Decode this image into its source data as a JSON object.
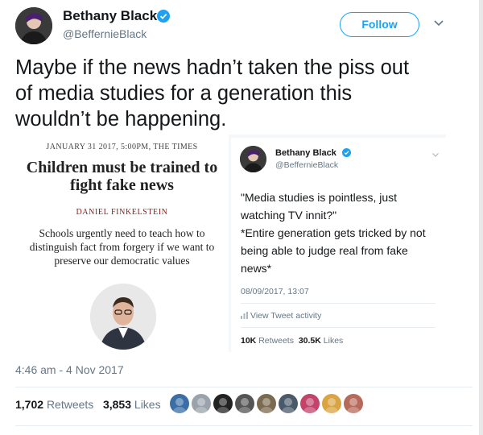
{
  "author": {
    "display_name": "Bethany Black",
    "handle": "@BeffernieBlack",
    "verified": true
  },
  "follow_label": "Follow",
  "tweet_lines": [
    "Maybe if the news hadn’t taken the piss out",
    "of media studies for a generation this",
    "wouldn’t be happening."
  ],
  "news_clip": {
    "dateline": "JANUARY 31 2017, 5:00PM, THE TIMES",
    "headline_lines": [
      "Children must be trained to",
      "fight fake news"
    ],
    "author": "DANIEL FINKELSTEIN",
    "summary_lines": [
      "Schools urgently need to teach how to",
      "distinguish fact from forgery if we want to",
      "preserve our democratic values"
    ]
  },
  "embedded_tweet": {
    "display_name": "Bethany Black",
    "handle": "@BeffernieBlack",
    "text_lines": [
      "\"Media studies is pointless, just",
      "watching TV innit?\"",
      "*Entire generation gets tricked by not",
      "being able to judge real from fake",
      "news*"
    ],
    "timestamp": "08/09/2017, 13:07",
    "activity_label": "View Tweet activity",
    "retweets_count": "10K",
    "retweets_label": "Retweets",
    "likes_count": "30.5K",
    "likes_label": "Likes"
  },
  "timestamp": "4:46 am - 4 Nov 2017",
  "stats": {
    "retweets_count": "1,702",
    "retweets_label": "Retweets",
    "likes_count": "3,853",
    "likes_label": "Likes"
  },
  "colors": {
    "accent": "#1da1f2",
    "text": "#14171a",
    "secondary": "#657786"
  },
  "liker_avatar_colors": [
    "#3a6ea5",
    "#9aa3ab",
    "#222222",
    "#555555",
    "#7a6a4f",
    "#4a5a6a",
    "#c2446b",
    "#d9a441",
    "#b86a5a"
  ]
}
